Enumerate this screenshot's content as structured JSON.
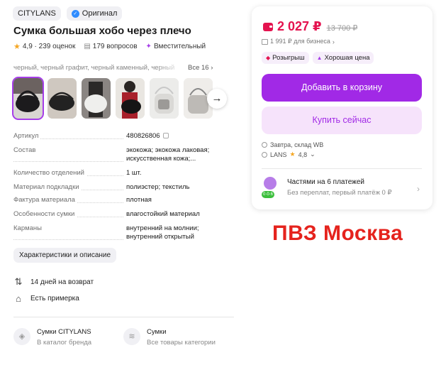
{
  "badges": {
    "brand": "CITYLANS",
    "original": "Оригинал"
  },
  "product": {
    "title": "Сумка большая хобо через плечо",
    "rating": "4,9",
    "reviews": "239 оценок",
    "questions": "179 вопросов",
    "feature": "Вместительный"
  },
  "colors": {
    "list": "черный, черный графит, черный каменный, черный",
    "all_label": "Все 16"
  },
  "gallery": {
    "thumbs": [
      {
        "name": "bag-black-front",
        "active": true
      },
      {
        "name": "bag-black-side",
        "active": false
      },
      {
        "name": "bag-white-model",
        "active": false
      },
      {
        "name": "bag-black-model",
        "active": false
      },
      {
        "name": "bag-white-clear",
        "active": false
      },
      {
        "name": "bag-grey",
        "active": false
      }
    ]
  },
  "specs": [
    {
      "key": "Артикул",
      "value": "480826806"
    },
    {
      "key": "Состав",
      "value": "экокожа; экокожа лаковая; искусственная кожа;..."
    },
    {
      "key": "Количество отделений",
      "value": "1 шт."
    },
    {
      "key": "Материал подкладки",
      "value": "полиэстер; текстиль"
    },
    {
      "key": "Фактура материала",
      "value": "плотная"
    },
    {
      "key": "Особенности сумки",
      "value": "влагостойкий материал"
    },
    {
      "key": "Карманы",
      "value": "внутренний на молнии; внутренний открытый"
    }
  ],
  "characteristics_button": "Характеристики и описание",
  "services": {
    "return": "14 дней на возврат",
    "fitting": "Есть примерка"
  },
  "links": {
    "brand_title": "Сумки CITYLANS",
    "brand_sub": "В каталог бренда",
    "cat_title": "Сумки",
    "cat_sub": "Все товары категории"
  },
  "card": {
    "price": "2 027 ₽",
    "old_price": "13 700 ₽",
    "business_price": "1 991 ₽ для бизнеса",
    "tag_lottery": "Розыгрыш",
    "tag_good_price": "Хорошая цена",
    "add_to_cart": "Добавить в корзину",
    "buy_now": "Купить сейчас",
    "delivery": "Завтра, склад WB",
    "seller": "LANS",
    "seller_rating": "4,8",
    "installments_title": "Частями на 6 платежей",
    "installments_sub": "Без переплат, первый платёж 0 ₽",
    "installments_badge": "0·0·6"
  },
  "overlay_text": "ПВЗ Москва",
  "colors_theme": {
    "accent": "#a129e6",
    "price": "#e4134f",
    "overlay": "#e5231d"
  }
}
